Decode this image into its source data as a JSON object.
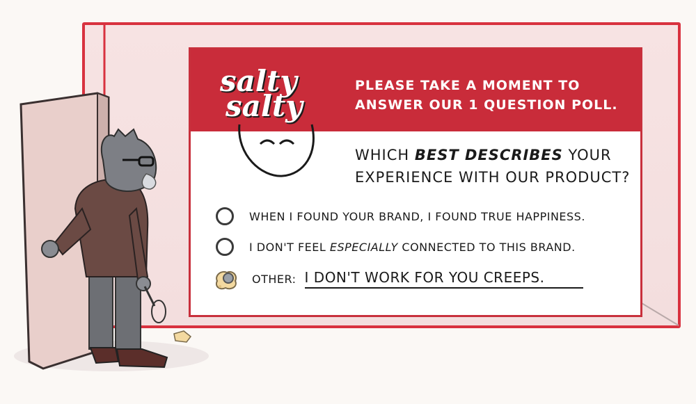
{
  "brand": {
    "line1": "salty",
    "line2": "salty"
  },
  "banner": {
    "message": "PLEASE TAKE A MOMENT TO ANSWER OUR 1 QUESTION POLL."
  },
  "question": {
    "pre": "WHICH ",
    "emph": "BEST DESCRIBES",
    "post": " YOUR EXPERIENCE WITH OUR PRODUCT?"
  },
  "options": [
    {
      "label": "WHEN I FOUND YOUR BRAND, I FOUND TRUE HAPPINESS."
    },
    {
      "pre": "I DON'T FEEL ",
      "emph": "ESPECIALLY",
      "post": " CONNECTED TO THIS BRAND."
    }
  ],
  "other": {
    "label": "OTHER:",
    "answer": "I DON'T WORK FOR YOU CREEPS."
  },
  "colors": {
    "banner": "#c92c3a",
    "frame": "#d8323f",
    "paper": "#ffffff"
  }
}
